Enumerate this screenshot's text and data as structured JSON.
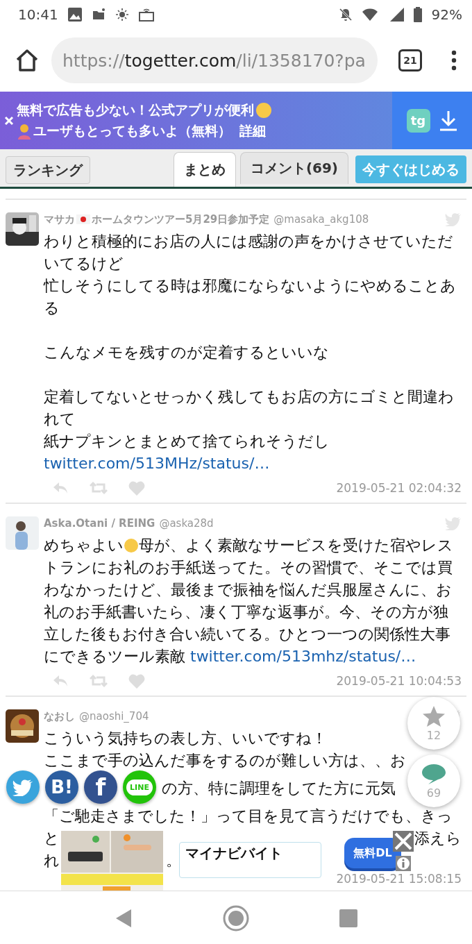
{
  "status_bar": {
    "time": "10:41",
    "battery": "92%"
  },
  "browser": {
    "url_scheme": "https://",
    "url_host": "togetter.com",
    "url_path": "/li/1358170?pa",
    "tab_count": "21"
  },
  "banner": {
    "line1": "無料で広告も少ない！公式アプリが便利",
    "line2": "ユーザもとっても多いよ（無料）",
    "link": "詳細",
    "logo_text": "tg"
  },
  "nav": {
    "ranking": "ランキング",
    "tabs": [
      {
        "label": "まとめ",
        "selected": true
      },
      {
        "label": "コメント(69)",
        "selected": false
      }
    ],
    "cta": "今すぐはじめる"
  },
  "tweets": [
    {
      "name_parts": [
        {
          "kind": "text",
          "text": "マサカ"
        },
        {
          "kind": "flag"
        },
        {
          "kind": "text",
          "text": "ホームタウンツアー5月29日参加予定"
        }
      ],
      "handle": "@masaka_akg108",
      "time": "2019-05-21 02:04:32",
      "blocks": [
        {
          "kind": "text",
          "text": "わりと積極的にお店の人には感謝の声をかけさせていただいてるけど"
        },
        {
          "kind": "text",
          "text": "忙しそうにしてる時は邪魔にならないようにやめることある"
        },
        {
          "kind": "text-after-gap",
          "text": "こんなメモを残すのが定着するといいな"
        },
        {
          "kind": "text-after-gap",
          "text": "定着してないとせっかく残してもお店の方にゴミと間違われて"
        },
        {
          "kind": "text",
          "text": "紙ナプキンとまとめて捨てられそうだし"
        },
        {
          "kind": "link",
          "text": "twitter.com/513MHz/status/…"
        }
      ]
    },
    {
      "name_parts": [
        {
          "kind": "text",
          "text": "Aska.Otani / REING"
        }
      ],
      "handle": "@aska28d",
      "time": "2019-05-21 10:04:53",
      "body": [
        {
          "kind": "text",
          "text": "めちゃよい"
        },
        {
          "kind": "emoji"
        },
        {
          "kind": "text",
          "text": "母が、よく素敵なサービスを受けた宿やレストランにお礼のお手紙送ってた。その習慣で、そこでは買わなかったけど、最後まで振袖を悩んだ呉服屋さんに、お礼のお手紙書いたら、凄く丁寧な返事が。今、その方が独立した後もお付き合い続いてる。ひとつ一つの関係性大事にできるツール素敵 "
        },
        {
          "kind": "link",
          "text": "twitter.com/513mhz/status/…"
        }
      ]
    },
    {
      "name_parts": [
        {
          "kind": "text",
          "text": "なおし"
        }
      ],
      "handle": "@naoshi_704",
      "time": "2019-05-21 15:08:15",
      "lines": [
        {
          "kind": "full",
          "parts": [
            "こういう気持ちの表し方、いいですね！"
          ]
        },
        {
          "kind": "full",
          "parts": [
            "ここまで手の込んだ事をするのが難しい方は、、お"
          ]
        },
        {
          "kind": "after-share",
          "parts": [
            "の方、特に調理をしてた方に元気"
          ]
        },
        {
          "kind": "full",
          "parts": [
            "「ご馳走さまでした！」って目を見て言うだけでも、きっ"
          ]
        },
        {
          "kind": "split",
          "parts": [
            "と",
            "添えら"
          ]
        },
        {
          "kind": "after-ad",
          "parts": [
            "れ",
            "。"
          ]
        }
      ]
    }
  ],
  "fabs": [
    {
      "kind": "star",
      "count": "12"
    },
    {
      "kind": "comment",
      "count": "69"
    }
  ],
  "share": [
    {
      "kind": "twitter"
    },
    {
      "kind": "hatena",
      "text": "B!"
    },
    {
      "kind": "facebook",
      "text": "f"
    },
    {
      "kind": "line",
      "text": "LINE"
    }
  ],
  "ad": {
    "title": "マイナビバイト",
    "button": "無料DL"
  }
}
